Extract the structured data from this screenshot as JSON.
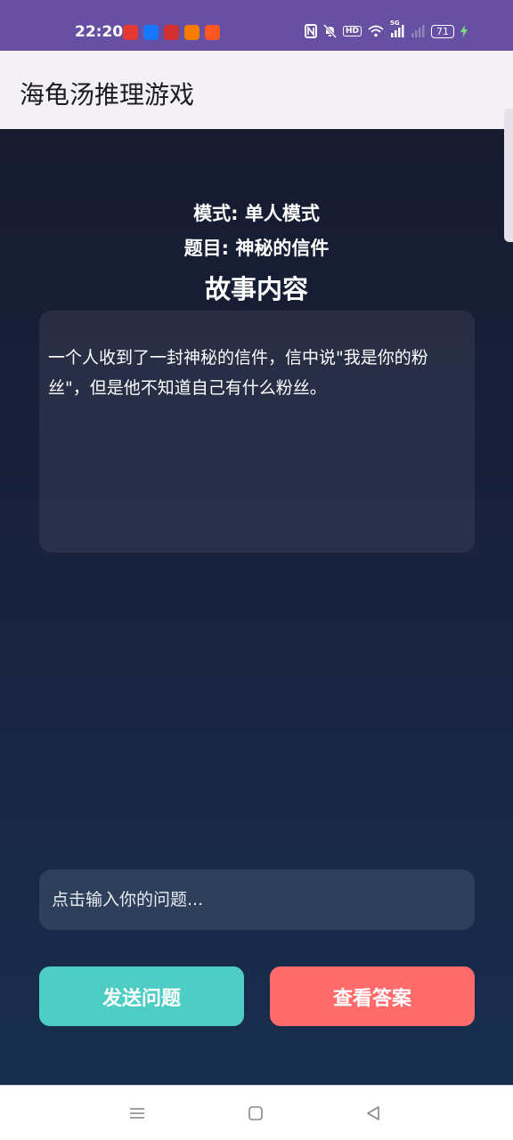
{
  "status_bar": {
    "time": "22:20",
    "app_icons": [
      {
        "name": "video-app-icon",
        "color": "#e53935"
      },
      {
        "name": "alipay-icon",
        "color": "#1677ff"
      },
      {
        "name": "news-app-icon",
        "color": "#d32f2f"
      },
      {
        "name": "weibo-icon",
        "color": "#f57c00"
      },
      {
        "name": "taobao-app-icon",
        "color": "#ff5722"
      }
    ],
    "hd_label": "HD",
    "signal_label": "5G",
    "battery_level": "71"
  },
  "app_bar": {
    "title": "海龟汤推理游戏"
  },
  "main": {
    "mode": "模式: 单人模式",
    "topic": "题目: 神秘的信件",
    "story_heading": "故事内容",
    "story_text": "一个人收到了一封神秘的信件，信中说\"我是你的粉丝\"，但是他不知道自己有什么粉丝。",
    "input_placeholder": "点击输入你的问题...",
    "send_button": "发送问题",
    "answer_button": "查看答案"
  },
  "colors": {
    "status_bar": "#6750a4",
    "send_button": "#4ecdc4",
    "answer_button": "#ff6b6b",
    "background_top": "#161b2e",
    "background_bottom": "#182d4e"
  }
}
